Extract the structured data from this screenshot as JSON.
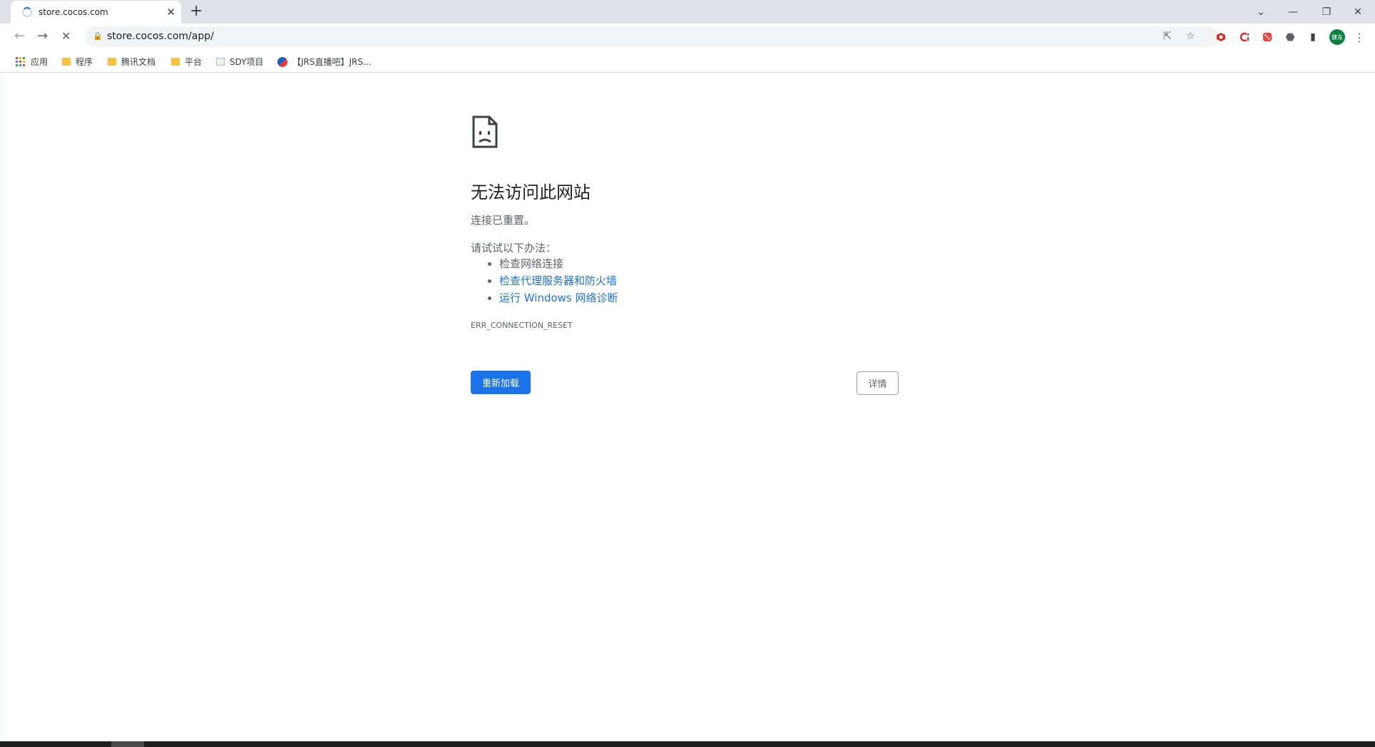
{
  "browser": {
    "tab": {
      "title": "store.cocos.com",
      "close": "✕"
    },
    "new_tab": "+",
    "window": {
      "tab_search": "⌄",
      "minimize": "—",
      "restore": "❐",
      "close": "✕"
    },
    "toolbar": {
      "back": "←",
      "forward": "→",
      "stop": "✕",
      "lock": "🔒",
      "url": "store.cocos.com/app/",
      "share": "⇱",
      "star": "☆",
      "extensions": "⬣",
      "sidepanel": "▮",
      "menu": "⋮",
      "avatar_text": "健东"
    },
    "bookmarks": [
      {
        "label": "应用",
        "icon": "apps-grid"
      },
      {
        "label": "程序",
        "icon": "folder"
      },
      {
        "label": "腾讯文档",
        "icon": "folder"
      },
      {
        "label": "平台",
        "icon": "folder"
      },
      {
        "label": "SDY项目",
        "icon": "page"
      },
      {
        "label": "【JRS直播吧】JRS...",
        "icon": "site"
      }
    ]
  },
  "error_page": {
    "heading": "无法访问此网站",
    "subtitle": "连接已重置。",
    "suggestions_title": "请试试以下办法：",
    "suggestions": [
      "检查网络连接",
      "检查代理服务器和防火墙",
      "运行 Windows 网络诊断"
    ],
    "error_code": "ERR_CONNECTION_RESET",
    "reload_button": "重新加载",
    "details_button": "详情"
  },
  "colors": {
    "accent": "#1a73e8",
    "tabbar": "#dee1e6",
    "text": "#202124",
    "secondary": "#5f6368"
  }
}
